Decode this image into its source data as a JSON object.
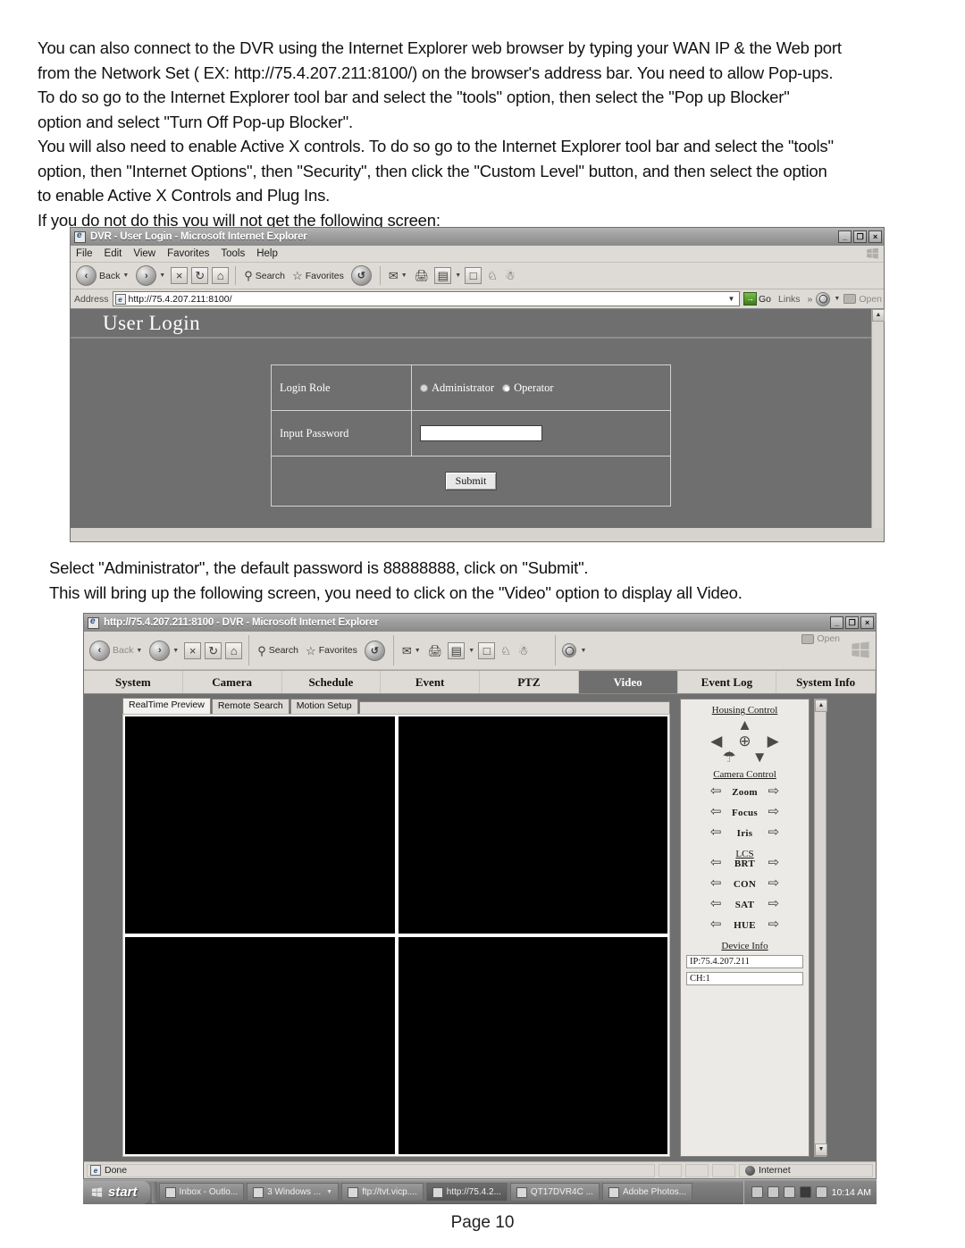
{
  "intro_paragraph": [
    "You can also connect to the DVR using the Internet Explorer web browser by typing your WAN IP & the Web port",
    "from the Network Set ( EX: http://75.4.207.211:8100/) on the browser's address bar. You need to allow Pop-ups.",
    "To do so go to the Internet Explorer tool bar and select the \"tools\" option, then select the \"Pop up Blocker\"",
    "option and select \"Turn Off Pop-up Blocker\".",
    "You will also need to enable Active X controls. To do so go to the Internet Explorer tool bar and select the \"tools\"",
    "option, then \"Internet Options\", then \"Security\",  then click the \"Custom Level\" button, and then select the option",
    "to enable Active X Controls and Plug Ins.",
    "If you do not do this you will not get the following screen:"
  ],
  "mid_paragraph": [
    "Select \"Administrator\", the default password is 88888888, click on \"Submit\".",
    "This will bring up the following screen, you need to click on the \"Video\" option to display all Video."
  ],
  "page_footer": "Page 10",
  "login_window": {
    "title": "DVR - User Login - Microsoft Internet Explorer",
    "window_buttons": {
      "minimize": "_",
      "restore": "❐",
      "close": "×"
    },
    "menu": [
      "File",
      "Edit",
      "View",
      "Favorites",
      "Tools",
      "Help"
    ],
    "toolbar": {
      "back": "Back",
      "forward": "",
      "stop": "×",
      "refresh": "↻",
      "home": "⌂",
      "search": "Search",
      "favorites": "Favorites",
      "history": "↺",
      "mail": "✉",
      "print": "⎙",
      "edit": "▤",
      "discuss": "□",
      "messenger": "♟",
      "research": "☺"
    },
    "address": {
      "label": "Address",
      "value": "http://75.4.207.211:8100/",
      "go": "Go",
      "links": "Links",
      "chevrons": "»",
      "open": "Open"
    },
    "page": {
      "heading": "User Login",
      "rows": [
        {
          "label": "Login Role",
          "type": "radio",
          "options": [
            {
              "label": "Administrator",
              "selected": false
            },
            {
              "label": "Operator",
              "selected": true
            }
          ]
        },
        {
          "label": "Input Password",
          "type": "password",
          "value": ""
        }
      ],
      "submit_label": "Submit"
    }
  },
  "dvr_window": {
    "title": "http://75.4.207.211:8100 - DVR - Microsoft Internet Explorer",
    "window_buttons": {
      "minimize": "_",
      "restore": "❐",
      "close": "×"
    },
    "toolbar": {
      "back": "Back",
      "search": "Search",
      "favorites": "Favorites",
      "open": "Open"
    },
    "nav_tabs": [
      {
        "label": "System",
        "active": false
      },
      {
        "label": "Camera",
        "active": false
      },
      {
        "label": "Schedule",
        "active": false
      },
      {
        "label": "Event",
        "active": false
      },
      {
        "label": "PTZ",
        "active": false
      },
      {
        "label": "Video",
        "active": true
      },
      {
        "label": "Event Log",
        "active": false
      },
      {
        "label": "System Info",
        "active": false
      }
    ],
    "sub_tabs": [
      {
        "label": "RealTime Preview",
        "active": true
      },
      {
        "label": "Remote Search",
        "active": false
      },
      {
        "label": "Motion Setup",
        "active": false
      }
    ],
    "video_cells": [
      "",
      "",
      "",
      ""
    ],
    "housing_control": {
      "title": "Housing Control",
      "up": "▲",
      "left": "◀",
      "center": "⊕",
      "right": "▶",
      "wiper": "☂",
      "down": "▼"
    },
    "camera_control": {
      "title": "Camera Control",
      "rows": [
        {
          "label": "Zoom",
          "left": "⇦",
          "right": "⇨"
        },
        {
          "label": "Focus",
          "left": "⇦",
          "right": "⇨"
        },
        {
          "label": "Iris",
          "left": "⇦",
          "right": "⇨"
        }
      ]
    },
    "lcs": {
      "title": "LCS",
      "rows": [
        {
          "label": "BRT",
          "left": "⇦",
          "right": "⇨"
        },
        {
          "label": "CON",
          "left": "⇦",
          "right": "⇨"
        },
        {
          "label": "SAT",
          "left": "⇦",
          "right": "⇨"
        },
        {
          "label": "HUE",
          "left": "⇦",
          "right": "⇨"
        }
      ]
    },
    "device_info": {
      "title": "Device Info",
      "ip": "IP:75.4.207.211",
      "channel": "CH:1"
    },
    "status_bar": {
      "status": "Done",
      "zone": "Internet"
    }
  },
  "taskbar": {
    "start_label": "start",
    "items": [
      {
        "label": "Inbox - Outlo...",
        "active": false,
        "caret": false
      },
      {
        "label": "3 Windows ...",
        "active": false,
        "caret": true
      },
      {
        "label": "ftp://tvt.vicp....",
        "active": false,
        "caret": false
      },
      {
        "label": "http://75.4.2...",
        "active": true,
        "caret": false
      },
      {
        "label": "QT17DVR4C ...",
        "active": false,
        "caret": false
      },
      {
        "label": "Adobe Photos...",
        "active": false,
        "caret": false
      }
    ],
    "clock": "10:14 AM"
  }
}
